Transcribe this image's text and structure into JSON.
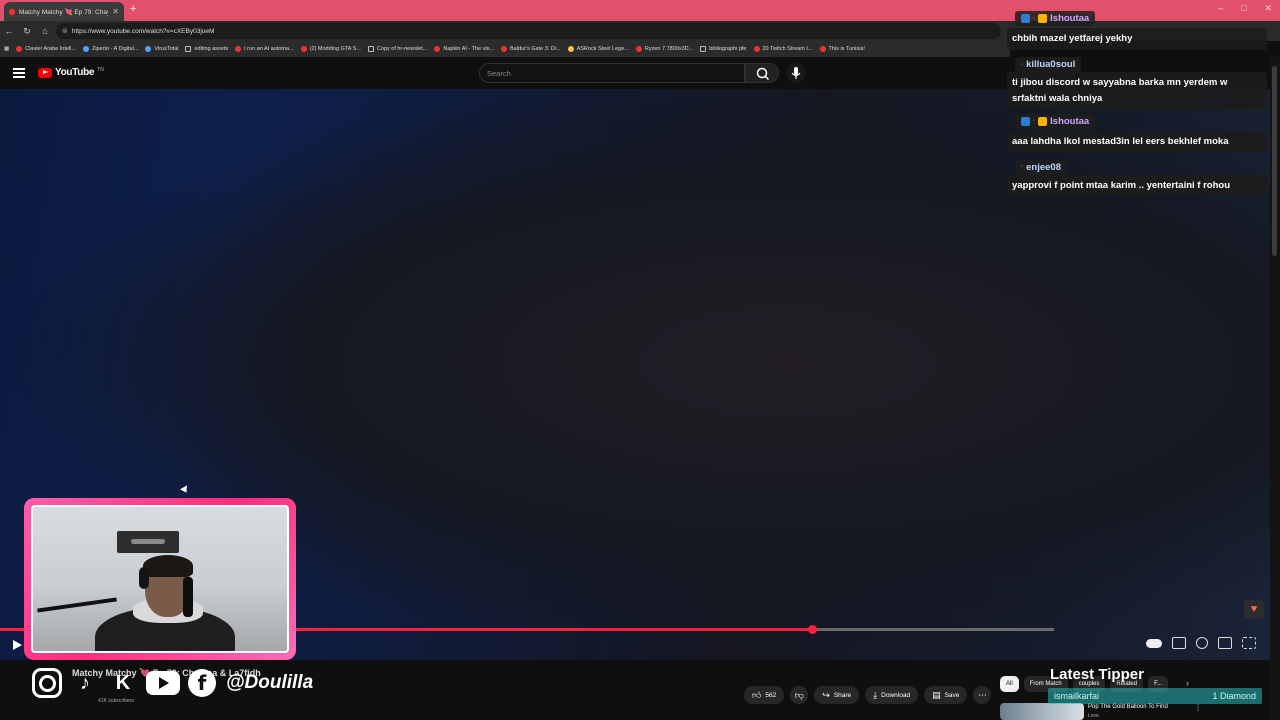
{
  "browser": {
    "tab_title": "Matchy Matchy 💘 Ep 79: Chayma",
    "url": "https://www.youtube.com/watch?v=cXEBy03jueM",
    "bookmarks": [
      {
        "label": "Clavier Arabe Intell...",
        "color": "red"
      },
      {
        "label": "Ziperto - A Digital...",
        "color": "blue"
      },
      {
        "label": "VirusTotal",
        "color": "blue"
      },
      {
        "label": "editing assets",
        "color": "folder"
      },
      {
        "label": "I run an AI automa...",
        "color": "red"
      },
      {
        "label": "(2) Modding GTA S...",
        "color": "red"
      },
      {
        "label": "Copy of hr-newslet...",
        "color": "folder"
      },
      {
        "label": "Napkin AI - The vis...",
        "color": "red"
      },
      {
        "label": "Baldur's Gate 3: Di...",
        "color": "red"
      },
      {
        "label": "ASRock Steel Lege...",
        "color": "yel"
      },
      {
        "label": "Ryzen 7 7800x3D...",
        "color": "red"
      },
      {
        "label": "bibliographi pfe",
        "color": "folder"
      },
      {
        "label": "20 Twitch Stream I...",
        "color": "red"
      },
      {
        "label": "This is Tunisia!",
        "color": "red"
      }
    ]
  },
  "youtube": {
    "logo_text": "YouTube",
    "logo_suffix": "TN",
    "search_placeholder": "Search",
    "video_title": "Matchy Matchy 💘 Ep 79: Chayma & La7fidh",
    "subscribers": "41K subscribers",
    "likes": "562",
    "share_label": "Share",
    "download_label": "Download",
    "save_label": "Save",
    "progress_fraction": 0.77,
    "chips": [
      "All",
      "From Match",
      "couples",
      "Related",
      "F..."
    ],
    "related": {
      "title": "Pop The Gold Balloon To Find",
      "sub": "Love"
    }
  },
  "overlay": {
    "handle": "@Doulilla",
    "latest_tipper_label": "Latest Tipper",
    "tipper_name": "ismailkarfai",
    "tipper_amount": "1 Diamond"
  },
  "chat": [
    {
      "user": "Ishoutaa",
      "text": "chbih mazel yetfarej yekhy",
      "user_class": "u-purple",
      "badges": true
    },
    {
      "user": "killua0soul",
      "text": "ti jibou discord w sayyabna barka mn yerdem w srfaktni wala chniya",
      "user_class": "u-blue",
      "badges": false
    },
    {
      "user": "Ishoutaa",
      "text": "aaa lahdha lkol mestad3in lel eers bekhlef moka",
      "user_class": "u-purple",
      "badges": true
    },
    {
      "user": "enjee08",
      "text": "yapprovi f point mtaa karim .. yentertaini f rohou",
      "user_class": "u-blue",
      "badges": false
    }
  ]
}
